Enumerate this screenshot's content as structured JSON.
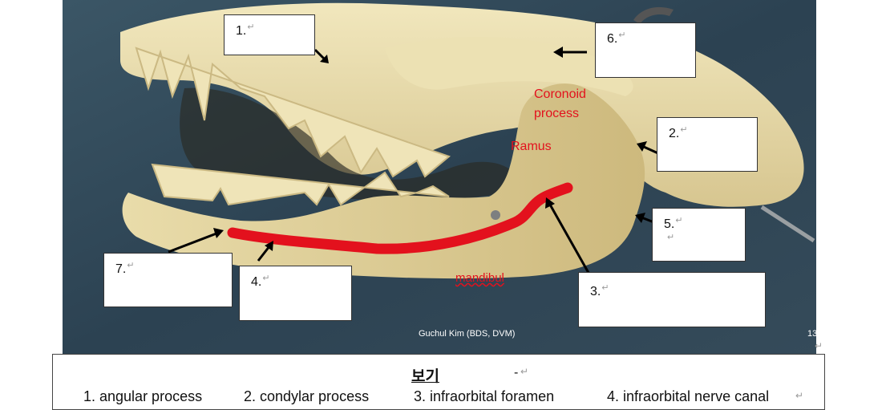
{
  "answer_boxes": [
    {
      "number": "1."
    },
    {
      "number": "6."
    },
    {
      "number": "2."
    },
    {
      "number": "5."
    },
    {
      "number": "7."
    },
    {
      "number": "4."
    },
    {
      "number": "3."
    }
  ],
  "return_mark": "↵",
  "image_labels": {
    "coronoid_process": "Coronoid process",
    "coronoid_line1": "Coronoid",
    "coronoid_line2": "process",
    "ramus": "Ramus",
    "mandibul": "mandibul"
  },
  "credit": "Guchul Kim (BDS, DVM)",
  "slide_number": "13",
  "legend": {
    "title": "보기",
    "title_suffix": "-",
    "items": [
      "1. angular process",
      "2. condylar process",
      "3. infraorbital foramen",
      "4. infraorbital nerve canal"
    ]
  },
  "colors": {
    "label_red": "#e3111d",
    "photo_background": "#2f4756",
    "bone": "#e6d9a6"
  }
}
